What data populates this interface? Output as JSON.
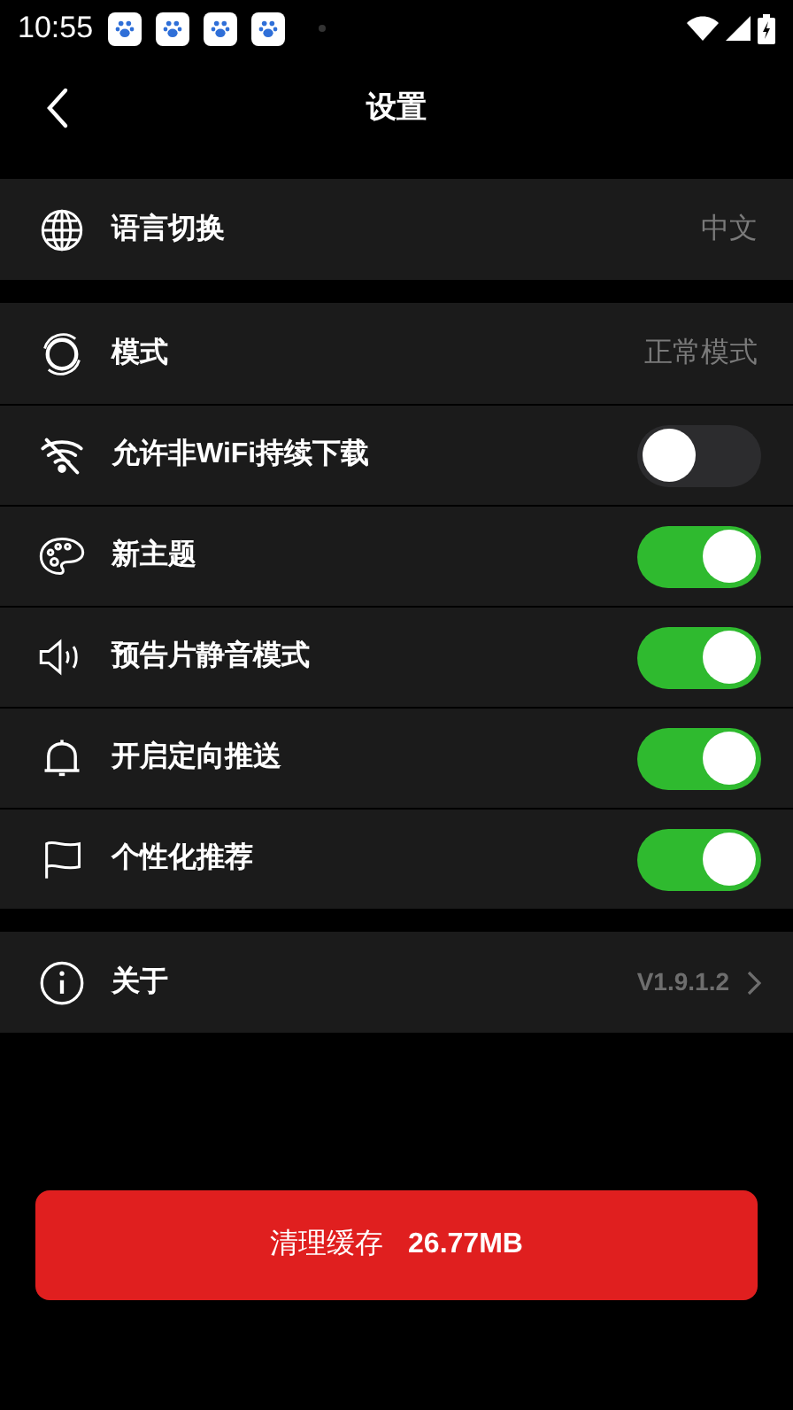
{
  "status_bar": {
    "time": "10:55"
  },
  "header": {
    "title": "设置"
  },
  "groups": [
    {
      "rows": [
        {
          "kind": "value",
          "label": "语言切换",
          "value": "中文"
        }
      ]
    },
    {
      "rows": [
        {
          "kind": "value",
          "label": "模式",
          "value": "正常模式"
        },
        {
          "kind": "toggle",
          "label": "允许非WiFi持续下载",
          "on": false
        },
        {
          "kind": "toggle",
          "label": "新主题",
          "on": true
        },
        {
          "kind": "toggle",
          "label": "预告片静音模式",
          "on": true
        },
        {
          "kind": "toggle",
          "label": "开启定向推送",
          "on": true
        },
        {
          "kind": "toggle",
          "label": "个性化推荐",
          "on": true
        }
      ]
    },
    {
      "rows": [
        {
          "kind": "link",
          "label": "关于",
          "value": "V1.9.1.2"
        }
      ]
    }
  ],
  "clear_button": {
    "label": "清理缓存",
    "size": "26.77MB"
  }
}
